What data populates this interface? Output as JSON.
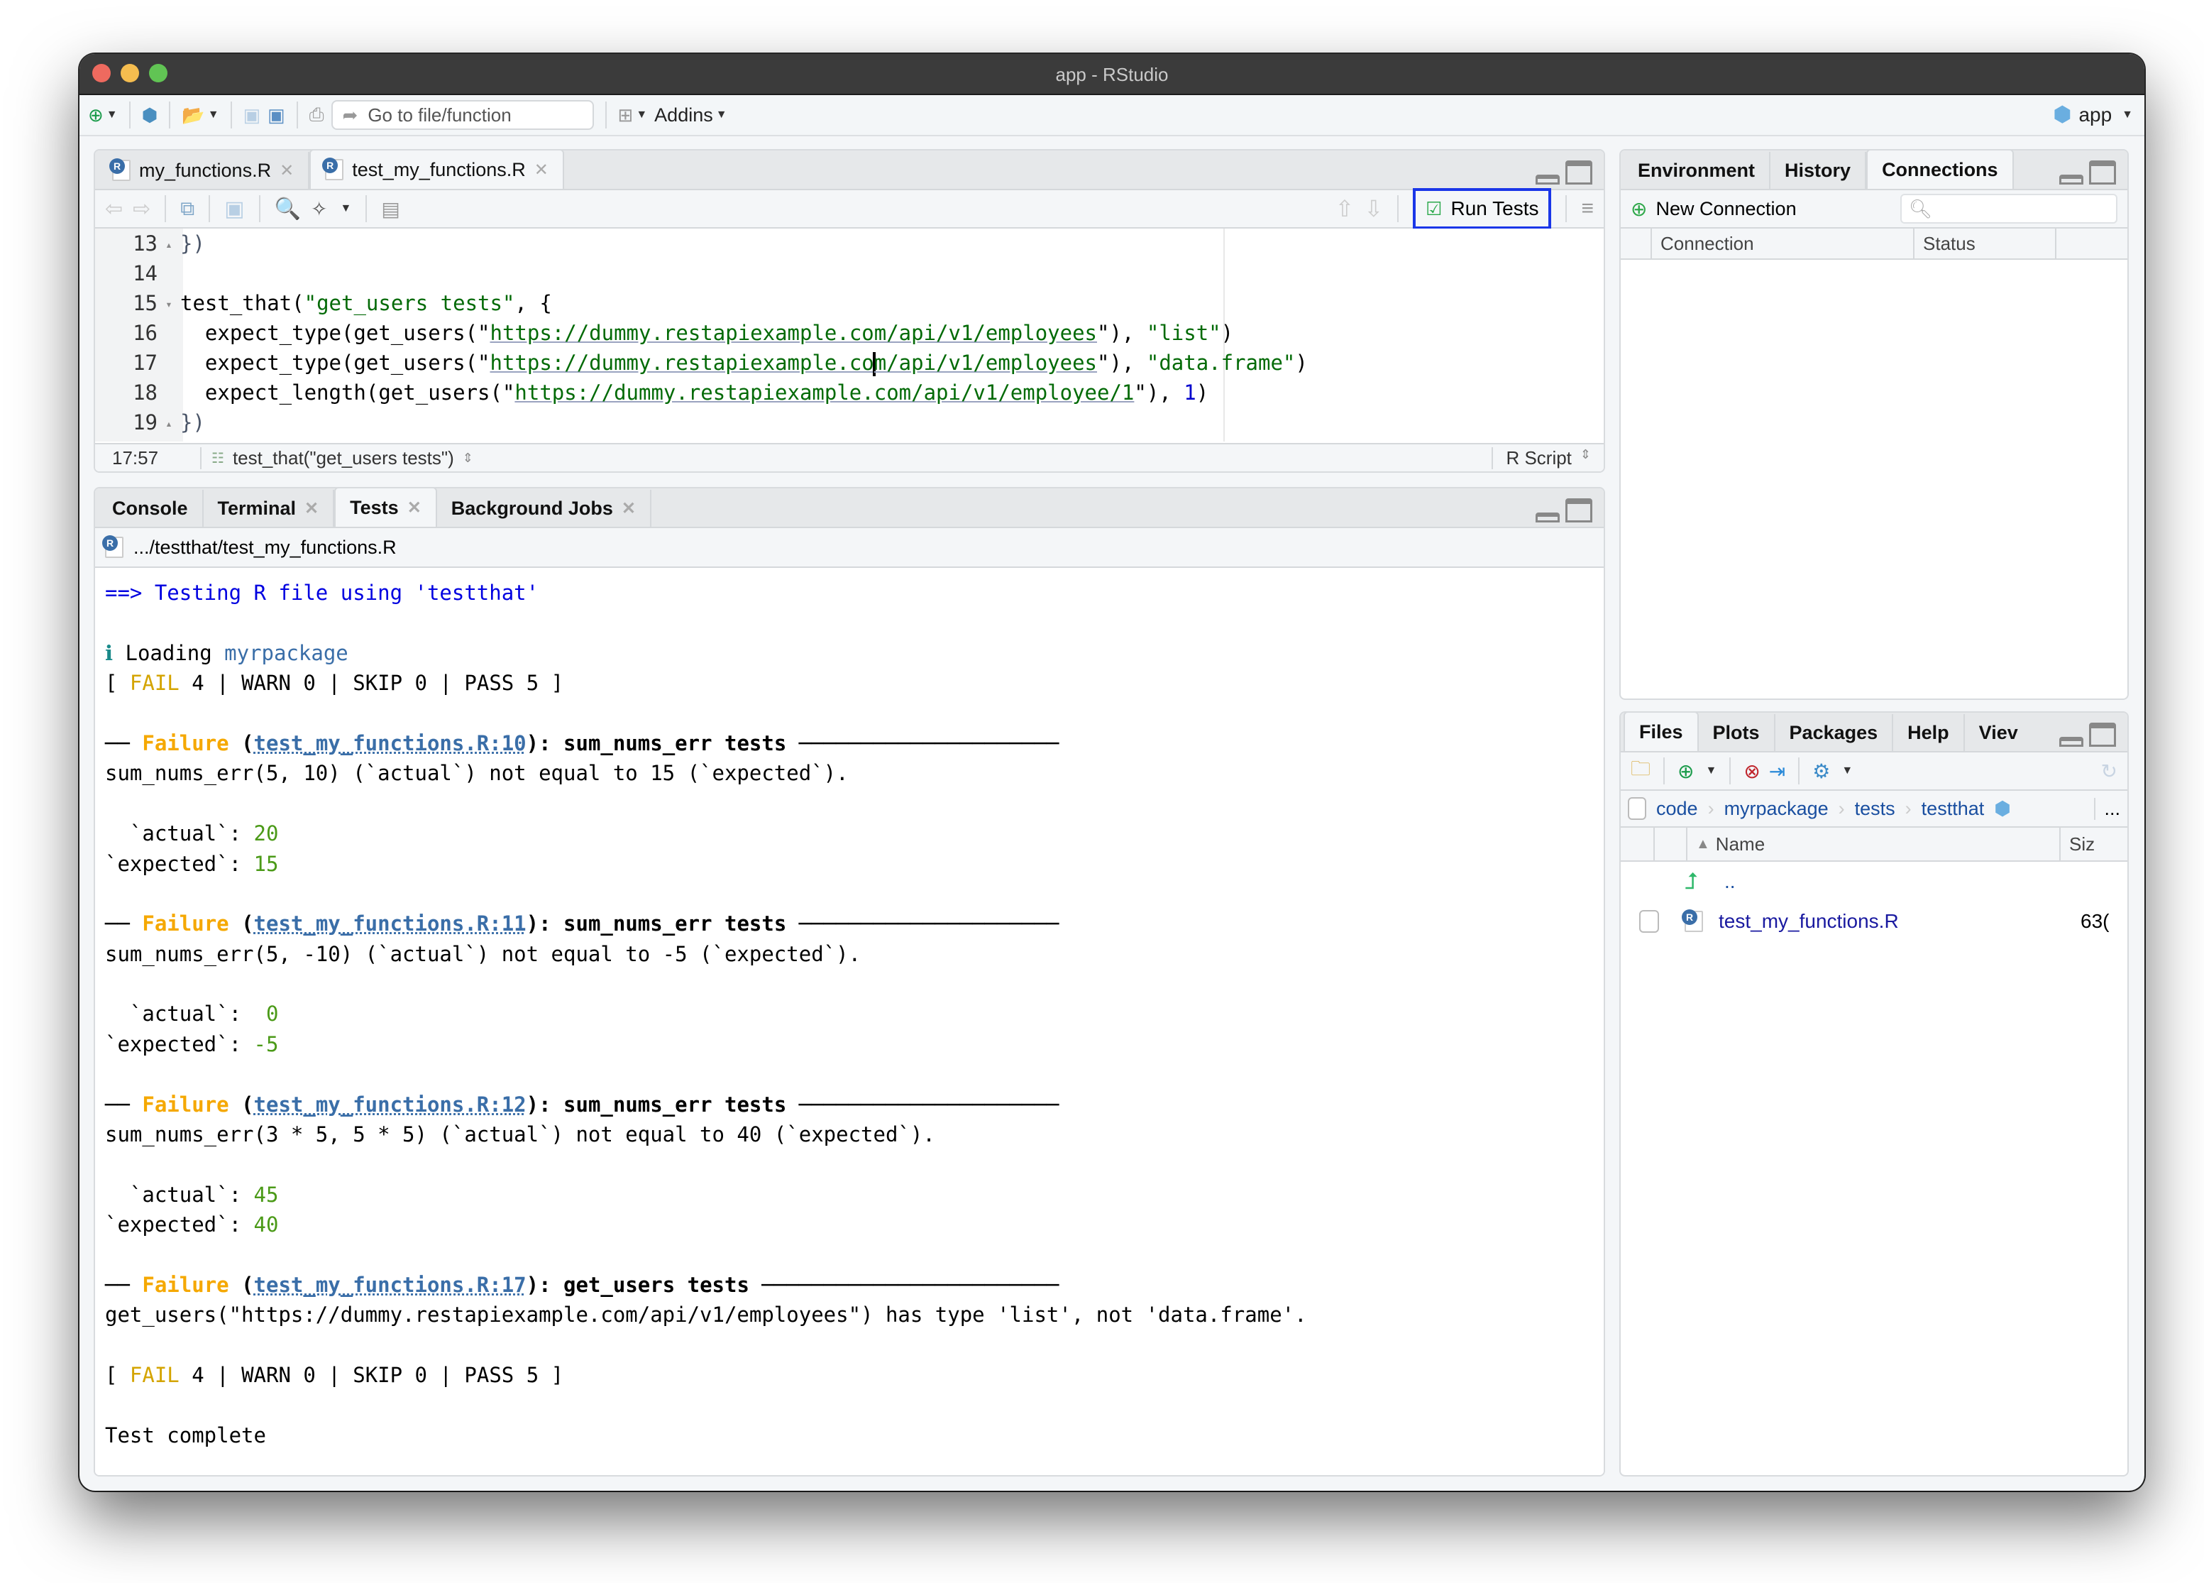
{
  "window": {
    "title": "app - RStudio",
    "traffic_lights": {
      "close": "#ee6a5f",
      "minimize": "#f5bd4f",
      "zoom": "#61c454"
    }
  },
  "main_toolbar": {
    "goto_placeholder": "Go to file/function",
    "addins_label": "Addins",
    "project_label": "app",
    "icons": [
      "new-file-icon",
      "new-project-icon",
      "open-file-icon",
      "save-icon",
      "save-all-icon",
      "print-icon",
      "pane-layout-icon"
    ]
  },
  "editor": {
    "tabs": [
      {
        "label": "my_functions.R",
        "active": false
      },
      {
        "label": "test_my_functions.R",
        "active": true
      }
    ],
    "toolbar": {
      "run_tests_label": "Run Tests"
    },
    "lines": [
      {
        "num": "13",
        "fold": "▴",
        "text": "})"
      },
      {
        "num": "14",
        "fold": "",
        "text": ""
      },
      {
        "num": "15",
        "fold": "▾",
        "fn": "test_that(",
        "str": "\"get_users tests\"",
        "rest": ", {"
      },
      {
        "num": "16",
        "fold": "",
        "pre": "  expect_type(get_users(\"",
        "url": "https://dummy.restapiexample.com/api/v1/employees",
        "post": "\"), ",
        "arg": "\"list\"",
        "end": ")"
      },
      {
        "num": "17",
        "fold": "",
        "pre": "  expect_type(get_users(\"",
        "url_a": "https://dummy.restapiexample.co",
        "url_b": "m/api/v1/employees",
        "post": "\"), ",
        "arg": "\"data.frame\"",
        "end": ")"
      },
      {
        "num": "18",
        "fold": "",
        "pre": "  expect_length(get_users(\"",
        "url": "https://dummy.restapiexample.com/api/v1/employee/1",
        "post": "\"), ",
        "num_arg": "1",
        "end": ")"
      },
      {
        "num": "19",
        "fold": "▴",
        "text": "})"
      }
    ],
    "status": {
      "position": "17:57",
      "scope": "test_that(\"get_users tests\")",
      "file_type": "R Script"
    }
  },
  "console_pane": {
    "tabs": [
      {
        "label": "Console",
        "closable": false,
        "active": false
      },
      {
        "label": "Terminal",
        "closable": true,
        "active": false
      },
      {
        "label": "Tests",
        "closable": true,
        "active": true
      },
      {
        "label": "Background Jobs",
        "closable": true,
        "active": false
      }
    ],
    "path": ".../testthat/test_my_functions.R",
    "output": {
      "header": "==> Testing R file using 'testthat'",
      "loading_prefix": "Loading",
      "loading_pkg": "myrpackage",
      "summary": {
        "fail_label": "FAIL",
        "fail": "4",
        "warn": "0",
        "skip": "0",
        "pass": "5"
      },
      "failures": [
        {
          "location": "test_my_functions.R:10",
          "test": "sum_nums_err tests",
          "message": "sum_nums_err(5, 10) (`actual`) not equal to 15 (`expected`).",
          "actual": "20",
          "expected": "15"
        },
        {
          "location": "test_my_functions.R:11",
          "test": "sum_nums_err tests",
          "message": "sum_nums_err(5, -10) (`actual`) not equal to -5 (`expected`).",
          "actual": " 0",
          "expected": "-5"
        },
        {
          "location": "test_my_functions.R:12",
          "test": "sum_nums_err tests",
          "message": "sum_nums_err(3 * 5, 5 * 5) (`actual`) not equal to 40 (`expected`).",
          "actual": "45",
          "expected": "40"
        },
        {
          "location": "test_my_functions.R:17",
          "test": "get_users tests",
          "message": "get_users(\"https://dummy.restapiexample.com/api/v1/employees\") has type 'list', not 'data.frame'."
        }
      ],
      "failure_label": "Failure",
      "complete": "Test complete"
    }
  },
  "env_pane": {
    "tabs": [
      {
        "label": "Environment"
      },
      {
        "label": "History"
      },
      {
        "label": "Connections",
        "active": true
      }
    ],
    "new_connection_label": "New Connection",
    "search_placeholder": "",
    "columns": [
      "Connection",
      "Status"
    ]
  },
  "files_pane": {
    "tabs": [
      {
        "label": "Files",
        "active": true
      },
      {
        "label": "Plots"
      },
      {
        "label": "Packages"
      },
      {
        "label": "Help"
      },
      {
        "label": "Viev"
      }
    ],
    "breadcrumb": [
      "code",
      "myrpackage",
      "tests",
      "testthat"
    ],
    "more": "...",
    "columns": {
      "name": "Name",
      "size": "Siz"
    },
    "rows": [
      {
        "name": "..",
        "up": true
      },
      {
        "name": "test_my_functions.R",
        "size": "63("
      }
    ]
  }
}
